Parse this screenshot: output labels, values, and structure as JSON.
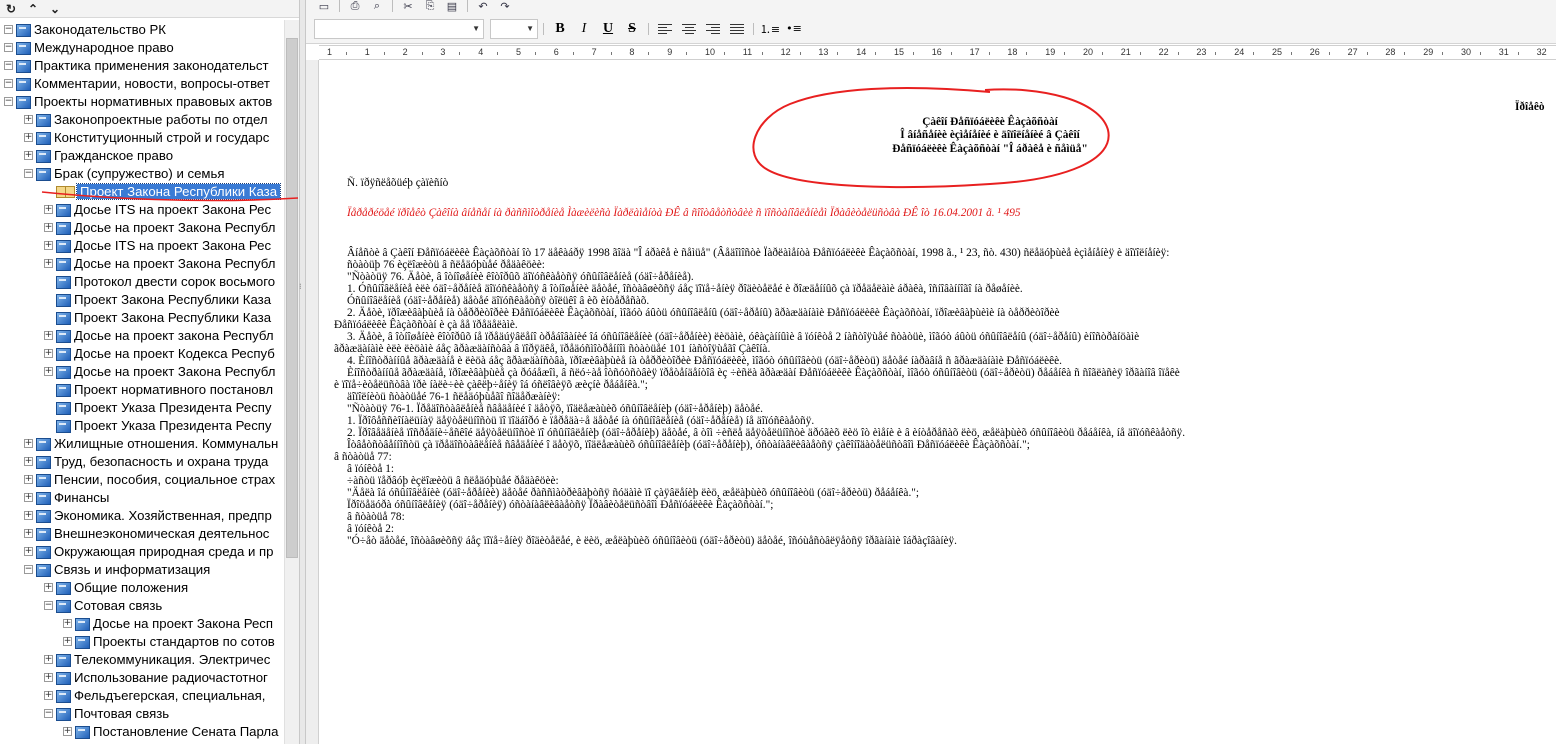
{
  "tree": {
    "items": [
      {
        "label": "Законодательство РК",
        "level": 0,
        "expander": "-",
        "selected": false
      },
      {
        "label": "Международное право",
        "level": 0,
        "expander": "-",
        "selected": false
      },
      {
        "label": "Практика применения законодательст",
        "level": 0,
        "expander": "-",
        "selected": false
      },
      {
        "label": "Комментарии, новости, вопросы-ответ",
        "level": 0,
        "expander": "-",
        "selected": false
      },
      {
        "label": "Проекты нормативных правовых актов",
        "level": 0,
        "expander": "-",
        "selected": false
      },
      {
        "label": "Законопроектные работы по отдел",
        "level": 1,
        "expander": "+",
        "selected": false
      },
      {
        "label": "Конституционный строй и государс",
        "level": 1,
        "expander": "+",
        "selected": false
      },
      {
        "label": "Гражданское право",
        "level": 1,
        "expander": "+",
        "selected": false
      },
      {
        "label": "Брак (супружество) и семья",
        "level": 1,
        "expander": "-",
        "selected": false
      },
      {
        "label": "Проект Закона Республики Каза",
        "level": 2,
        "expander": "",
        "selected": true
      },
      {
        "label": "Досье ITS на проект Закона Рес",
        "level": 2,
        "expander": "+",
        "selected": false
      },
      {
        "label": "Досье на проект Закона Республ",
        "level": 2,
        "expander": "+",
        "selected": false
      },
      {
        "label": "Досье ITS на проект Закона Рес",
        "level": 2,
        "expander": "+",
        "selected": false
      },
      {
        "label": "Досье на проект Закона Республ",
        "level": 2,
        "expander": "+",
        "selected": false
      },
      {
        "label": "Протокол двести сорок восьмого",
        "level": 2,
        "expander": "",
        "selected": false
      },
      {
        "label": "Проект Закона Республики Каза",
        "level": 2,
        "expander": "",
        "selected": false
      },
      {
        "label": "Проект Закона Республики Каза",
        "level": 2,
        "expander": "",
        "selected": false
      },
      {
        "label": "Досье на проект закона Республ",
        "level": 2,
        "expander": "+",
        "selected": false
      },
      {
        "label": "Досье на проект Кодекса Респуб",
        "level": 2,
        "expander": "+",
        "selected": false
      },
      {
        "label": "Досье на проект Закона Республ",
        "level": 2,
        "expander": "+",
        "selected": false
      },
      {
        "label": "Проект нормативного постановл",
        "level": 2,
        "expander": "",
        "selected": false
      },
      {
        "label": "Проект Указа Президента Респу",
        "level": 2,
        "expander": "",
        "selected": false
      },
      {
        "label": "Проект Указа Президента Респу",
        "level": 2,
        "expander": "",
        "selected": false
      },
      {
        "label": "Жилищные отношения. Коммунальн",
        "level": 1,
        "expander": "+",
        "selected": false
      },
      {
        "label": "Труд, безопасность и охрана труда",
        "level": 1,
        "expander": "+",
        "selected": false
      },
      {
        "label": "Пенсии, пособия, социальное страх",
        "level": 1,
        "expander": "+",
        "selected": false
      },
      {
        "label": "Финансы",
        "level": 1,
        "expander": "+",
        "selected": false
      },
      {
        "label": "Экономика. Хозяйственная, предпр",
        "level": 1,
        "expander": "+",
        "selected": false
      },
      {
        "label": "Внешнеэкономическая деятельнос",
        "level": 1,
        "expander": "+",
        "selected": false
      },
      {
        "label": "Окружающая природная среда и пр",
        "level": 1,
        "expander": "+",
        "selected": false
      },
      {
        "label": "Связь и информатизация",
        "level": 1,
        "expander": "-",
        "selected": false
      },
      {
        "label": "Общие положения",
        "level": 2,
        "expander": "+",
        "selected": false
      },
      {
        "label": "Сотовая связь",
        "level": 2,
        "expander": "-",
        "selected": false
      },
      {
        "label": "Досье на проект Закона Респ",
        "level": 3,
        "expander": "+",
        "selected": false
      },
      {
        "label": "Проекты стандартов по сотов",
        "level": 3,
        "expander": "+",
        "selected": false
      },
      {
        "label": "Телекоммуникация. Электричес",
        "level": 2,
        "expander": "+",
        "selected": false
      },
      {
        "label": "Использование радиочастотног",
        "level": 2,
        "expander": "+",
        "selected": false
      },
      {
        "label": "Фельдъегерская, специальная, ",
        "level": 2,
        "expander": "+",
        "selected": false
      },
      {
        "label": "Почтовая связь",
        "level": 2,
        "expander": "-",
        "selected": false
      },
      {
        "label": "Постановление Сената Парла",
        "level": 3,
        "expander": "+",
        "selected": false
      }
    ]
  },
  "toolbar": {
    "icons": [
      "new-document-icon",
      "print-icon",
      "print-preview-icon",
      "cut-icon",
      "copy-icon",
      "paste-icon",
      "undo-icon",
      "redo-icon"
    ],
    "format_buttons": [
      {
        "name": "bold-button",
        "glyph": "B"
      },
      {
        "name": "italic-button",
        "glyph": "I"
      },
      {
        "name": "underline-button",
        "glyph": "U"
      },
      {
        "name": "strikethrough-button",
        "glyph": "S"
      }
    ]
  },
  "ruler": {
    "numbers": [
      "1",
      "1",
      "2",
      "3",
      "4",
      "5",
      "6",
      "7",
      "8",
      "9",
      "10",
      "11",
      "12",
      "13",
      "14",
      "15",
      "16",
      "17",
      "18",
      "19",
      "20",
      "21",
      "22",
      "23",
      "24",
      "25",
      "26",
      "27",
      "28",
      "29",
      "30",
      "31",
      "32"
    ]
  },
  "document": {
    "title_lines": [
      "Çàêîí Ðåñïóáëèêè Êàçàõñòàí",
      "Î âíåñåíèè èçìåíåíèé è äîïîëíåíèé â Çàêîí",
      "Ðåñïóáëèêè Êàçàõñòàí \"Î áðàêå è ñåìüå\""
    ],
    "project_label": "Ïðîåêò",
    "intro": "Ñ. ïðÿñëåõüéþ çàïèñíò",
    "red_note": "Ïåðåðéöåé ïðîåêò Çàêîíà âíåñåí íà ðàññìîòðåíèå Ìàæèëèñà Ïàðëàìåíòà ÐÊ â ñîîòâåòñòâèè ñ ïîñòàíîâëåíèåì Ïðàâèòåëüñòâà ÐÊ îò 16.04.2001 ã. ¹ 495",
    "body_lines": [
      "Âíåñòè â Çàêîí Ðåñïóáëèêè Êàçàõñòàí îò 17 äåêàáðÿ 1998 ãîäà \"Î áðàêå è ñåìüå\" (Âåäîìîñòè Ïàðëàìåíòà Ðåñïóáëèêè Êàçàõñòàí, 1998 ã., ¹ 23, ñò. 430) ñëåäóþùèå èçìåíåíèÿ è äîïîëíåíèÿ:",
      "ñòàòüþ 76 èçëîæèòü â ñëåäóþùåé ðåäàêöèè:",
      "\"Ñòàòüÿ 76. Äåòè, â îòíîøåíèè êîòîðûõ äîïóñêàåòñÿ óñûíîâëåíèå (óäî÷åðåíèå).",
      "1. Óñûíîâëåíèå èëè óäî÷åðåíèå äîïóñêàåòñÿ â îòíîøåíèè äåòåé, îñòàâøèõñÿ áåç ïîïå÷åíèÿ ðîäèòåëåé è ðîæäåííûõ çà ïðåäåëàìè áðàêà, îñíîâàííîãî íà ðåøåíèè.",
      "Óñûíîâëåíèå (óäî÷åðåíèå) äåòåé äîïóñêàåòñÿ òîëüêî â èõ èíòåðåñàõ.",
      "2. Äåòè, ïðîæèâàþùèå íà òåððèòîðèè Ðåñïóáëèêè Êàçàõñòàí, ìîãóò áûòü óñûíîâëåíû (óäî÷åðåíû) ãðàæäàíàìè Ðåñïóáëèêè Êàçàõñòàí, ïðîæèâàþùèìè íà òåððèòîðèè",
      "Ðåñïóáëèêè Êàçàõñòàí è çà åå ïðåäåëàìè.",
      "3. Äåòè, â îòíîøåíèè êîòîðûõ íå ïðåäúÿâëåíî òðåáîâàíèé îá óñûíîâëåíèè (óäî÷åðåíèè) ëèöàìè, óêàçàííûìè â ïóíêòå 2 íàñòîÿùåé ñòàòüè, ìîãóò áûòü óñûíîâëåíû (óäî÷åðåíû) èíîñòðàíöàìè",
      "ãðàæäàíàìè èëè ëèöàìè áåç ãðàæäàíñòâà â ïîðÿäêå, ïðåäóñìîòðåííîì ñòàòüåé 101 íàñòîÿùåãî Çàêîíà.",
      "4. Èíîñòðàííûå ãðàæäàíå è ëèöà áåç ãðàæäàíñòâà, ïðîæèâàþùèå íà òåððèòîðèè Ðåñïóáëèêè, ìîãóò óñûíîâèòü (óäî÷åðèòü) äåòåé íàðàâíå ñ ãðàæäàíàìè Ðåñïóáëèêè.",
      "Èíîñòðàííûå ãðàæäàíå, ïðîæèâàþùèå çà ðóáåæîì, â ñëó÷àå îòñóòñòâèÿ ïðåòåíäåíòîâ èç ÷èñëà ãðàæäàí Ðåñïóáëèêè Êàçàõñòàí, ìîãóò óñûíîâèòü (óäî÷åðèòü) ðåáåíêà ñ ñîãëàñèÿ îðãàíîâ îïåêè",
      "è ïîïå÷èòåëüñòâà ïðè íàëè÷èè çàêëþ÷åíèÿ îá óñëîâèÿõ æèçíè ðåáåíêà.\";",
      "äîïîëíèòü ñòàòüåé 76-1 ñëåäóþùåãî ñîäåðæàíèÿ:",
      "\"Ñòàòüÿ 76-1. Ïðåäîñòàâëåíèå ñâåäåíèé î äåòÿõ, ïîäëåæàùèõ óñûíîâëåíèþ (óäî÷åðåíèþ) äåòåé.",
      "1. Ïðîôåññèîíàëüíàÿ äåÿòåëüíîñòü ïî ïîäáîðó è ïåðåäà÷å äåòåé íà óñûíîâëåíèå (óäî÷åðåíèå) íå äîïóñêàåòñÿ.",
      "2. Ïðîâåäåíèå ïîñðåäíè÷åñêîé äåÿòåëüíîñòè ïî óñûíîâëåíèþ (óäî÷åðåíèþ) äåòåé, â òîì ÷èñëå äåÿòåëüíîñòè äðóãèõ ëèö îò èìåíè è â èíòåðåñàõ ëèö, æåëàþùèõ óñûíîâèòü ðåáåíêà, íå äîïóñêàåòñÿ.",
      "Îòâåòñòâåííîñòü çà ïðåäîñòàâëåíèå ñâåäåíèé î äåòÿõ, ïîäëåæàùèõ óñûíîâëåíèþ (óäî÷åðåíèþ), óñòàíàâëèâàåòñÿ çàêîíîäàòåëüñòâîì Ðåñïóáëèêè Êàçàõñòàí.\";",
      "â ñòàòüå 77:",
      "â ïóíêòå 1:",
      "÷àñòü ïåðâóþ èçëîæèòü â ñëåäóþùåé ðåäàêöèè:",
      "\"Äåëà îá óñûíîâëåíèè (óäî÷åðåíèè) äåòåé ðàññìàòðèâàþòñÿ ñóäàìè ïî çàÿâëåíèþ ëèö, æåëàþùèõ óñûíîâèòü (óäî÷åðèòü) ðåáåíêà.\";",
      "Ïðîöåäóðà óñûíîâëåíèÿ (óäî÷åðåíèÿ) óñòàíàâëèâàåòñÿ Ïðàâèòåëüñòâîì Ðåñïóáëèêè Êàçàõñòàí.\";",
      "â ñòàòüå 78:",
      "â ïóíêòå 2:",
      "\"Ó÷åò äåòåé, îñòàâøèõñÿ áåç ïîïå÷åíèÿ ðîäèòåëåé, è ëèö, æåëàþùèõ óñûíîâèòü (óäî÷åðèòü) äåòåé, îñóùåñòâëÿåòñÿ îðãàíàìè îáðàçîâàíèÿ."
    ]
  }
}
